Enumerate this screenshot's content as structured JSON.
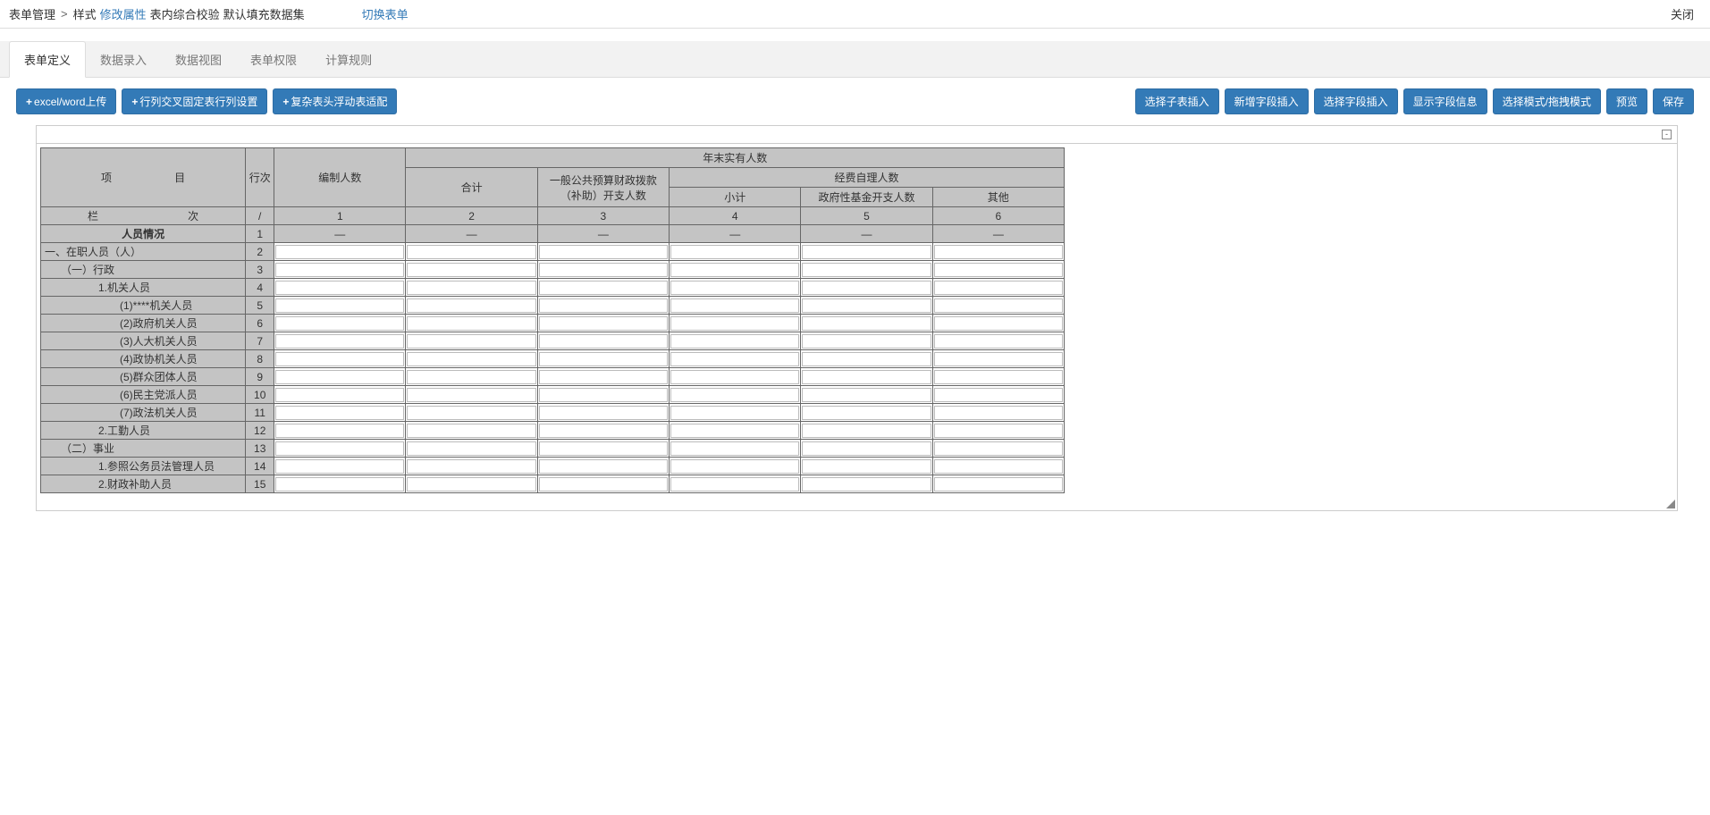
{
  "breadcrumb": {
    "root": "表单管理",
    "style": "样式",
    "modify": "修改属性",
    "validate": "表内综合校验",
    "dataset": "默认填充数据集",
    "switch": "切换表单",
    "close": "关闭"
  },
  "tabs": {
    "t0": "表单定义",
    "t1": "数据录入",
    "t2": "数据视图",
    "t3": "表单权限",
    "t4": "计算规则"
  },
  "buttons": {
    "upload": "excel/word上传",
    "rowcol": "行列交叉固定表行列设置",
    "complex": "复杂表头浮动表适配",
    "subtable": "选择子表插入",
    "newfield": "新增字段插入",
    "selfield": "选择字段插入",
    "showfield": "显示字段信息",
    "selmode": "选择模式/拖拽模式",
    "preview": "预览",
    "save": "保存"
  },
  "header": {
    "project_a": "项",
    "project_b": "目",
    "rownum": "行次",
    "col1": "编制人数",
    "top": "年末实有人数",
    "col2": "合计",
    "col3": "一般公共预算财政拨款（补助）开支人数",
    "sub": "经费自理人数",
    "col4": "小计",
    "col5": "政府性基金开支人数",
    "col6": "其他",
    "lanci_a": "栏",
    "lanci_b": "次",
    "slash": "/",
    "n1": "1",
    "n2": "2",
    "n3": "3",
    "n4": "4",
    "n5": "5",
    "n6": "6"
  },
  "rows": [
    {
      "label": "人员情况",
      "num": "1",
      "bold": true,
      "center": true,
      "dash": true
    },
    {
      "label": "一、在职人员（人）",
      "num": "2",
      "left": true
    },
    {
      "label": "（一）行政",
      "num": "3",
      "indent": 1
    },
    {
      "label": "1.机关人员",
      "num": "4",
      "indent": 2
    },
    {
      "label": "(1)****机关人员",
      "num": "5",
      "indent": 3
    },
    {
      "label": "(2)政府机关人员",
      "num": "6",
      "indent": 3
    },
    {
      "label": "(3)人大机关人员",
      "num": "7",
      "indent": 3
    },
    {
      "label": "(4)政协机关人员",
      "num": "8",
      "indent": 3
    },
    {
      "label": "(5)群众团体人员",
      "num": "9",
      "indent": 3
    },
    {
      "label": "(6)民主党派人员",
      "num": "10",
      "indent": 3
    },
    {
      "label": "(7)政法机关人员",
      "num": "11",
      "indent": 3
    },
    {
      "label": "2.工勤人员",
      "num": "12",
      "indent": 2
    },
    {
      "label": "（二）事业",
      "num": "13",
      "indent": 1
    },
    {
      "label": "1.参照公务员法管理人员",
      "num": "14",
      "indent": 2
    },
    {
      "label": "2.财政补助人员",
      "num": "15",
      "indent": 2,
      "partial": true
    }
  ],
  "dash": "—"
}
